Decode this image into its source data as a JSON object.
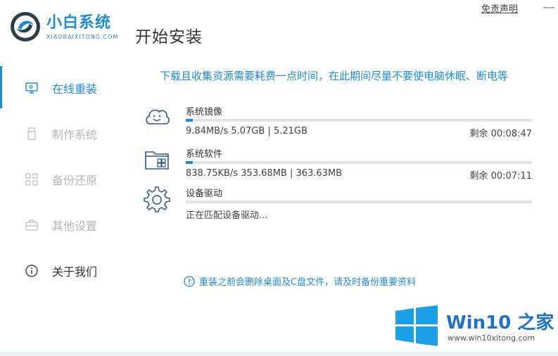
{
  "app": {
    "logo_title": "小白系统",
    "logo_subtitle": "XIAOBAIXITONG.COM",
    "page_title": "开始安装",
    "disclaimer": "免责声明",
    "close_glyph": "—"
  },
  "sidebar": {
    "items": [
      {
        "label": "在线重装",
        "icon": "monitor-icon",
        "state": "active"
      },
      {
        "label": "制作系统",
        "icon": "usb-icon",
        "state": "disabled"
      },
      {
        "label": "备份还原",
        "icon": "backup-icon",
        "state": "disabled"
      },
      {
        "label": "其他设置",
        "icon": "briefcase-icon",
        "state": "disabled"
      },
      {
        "label": "关于我们",
        "icon": "info-icon",
        "state": "normal"
      }
    ]
  },
  "main": {
    "notice": "下载且收集资源需要耗费一点时间，在此期间尽量不要使电脑休眠、断电等",
    "tasks": [
      {
        "name": "系统镜像",
        "icon": "cloud-face-icon",
        "progress": 0.02,
        "speed": "9.84MB/s 5.07GB | 5.21GB",
        "remain": "剩余 00:08:47"
      },
      {
        "name": "系统软件",
        "icon": "folder-apps-icon",
        "progress": 0.02,
        "speed": "838.75KB/s 353.68MB | 363.63MB",
        "remain": "剩余 00:07:11"
      },
      {
        "name": "设备驱动",
        "icon": "gear-icon",
        "progress": 0.0,
        "speed": "正在匹配设备驱动...",
        "remain": ""
      }
    ],
    "warning": "重装之前会删除桌面及C盘文件，请及时备份重要资料"
  },
  "watermark": {
    "title_brand": "Win10",
    "title_suffix": " 之家",
    "url": "www.win10xitong.com"
  },
  "colors": {
    "accent": "#1f8bd8",
    "disabled": "#b5b5b5",
    "track": "#dde3ea"
  }
}
